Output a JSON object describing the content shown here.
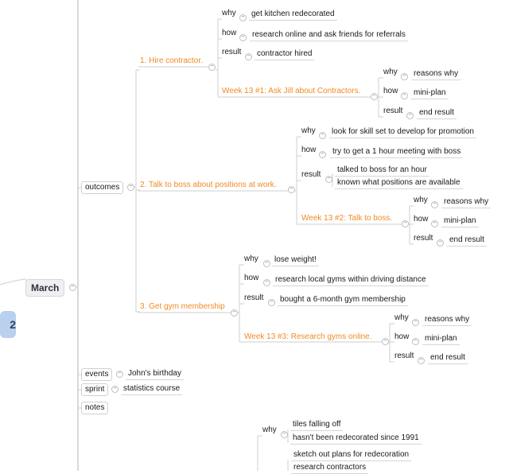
{
  "map": {
    "partial_node_text": "2",
    "root": {
      "label": "March",
      "children": [
        {
          "label": "outcomes",
          "children": [
            {
              "label": "1. Hire contractor.",
              "why": "get kitchen redecorated",
              "how": "research online and ask friends for referrals",
              "result": "contractor hired",
              "week": {
                "label": "Week 13 #1: Ask Jill about Contractors.",
                "why": "reasons why",
                "how": "mini-plan",
                "result": "end result"
              }
            },
            {
              "label": "2. Talk to boss about positions at work.",
              "why": "look for skill set to develop for promotion",
              "how": "try to get a 1 hour meeting with boss",
              "result": [
                "talked to boss for an hour",
                "known what positions are available"
              ],
              "week": {
                "label": "Week 13 #2: Talk to boss.",
                "why": "reasons why",
                "how": "mini-plan",
                "result": "end result"
              }
            },
            {
              "label": "3. Get gym membership",
              "why": "lose weight!",
              "how": "research local gyms within driving distance",
              "result": "bought a 6-month gym membership",
              "week": {
                "label": "Week 13 #3: Research gyms online.",
                "why": "reasons why",
                "how": "mini-plan",
                "result": "end result"
              }
            }
          ]
        },
        {
          "label": "events",
          "children": [
            "John's birthday"
          ]
        },
        {
          "label": "sprint",
          "children": [
            "statistics course"
          ]
        },
        {
          "label": "notes"
        }
      ]
    },
    "lower_branch": {
      "why_label": "why",
      "why_items": [
        "tiles falling off",
        "hasn't been redecorated since 1991"
      ],
      "next_items": [
        "sketch out plans for redecoration",
        "research contractors"
      ]
    },
    "labels": {
      "why": "why",
      "how": "how",
      "result": "result"
    },
    "colors": {
      "task_text": "#f08a24",
      "root_fill": "#eef0f4",
      "side_node_fill": "#b9d0ee",
      "connector": "#cfcfcf"
    }
  }
}
